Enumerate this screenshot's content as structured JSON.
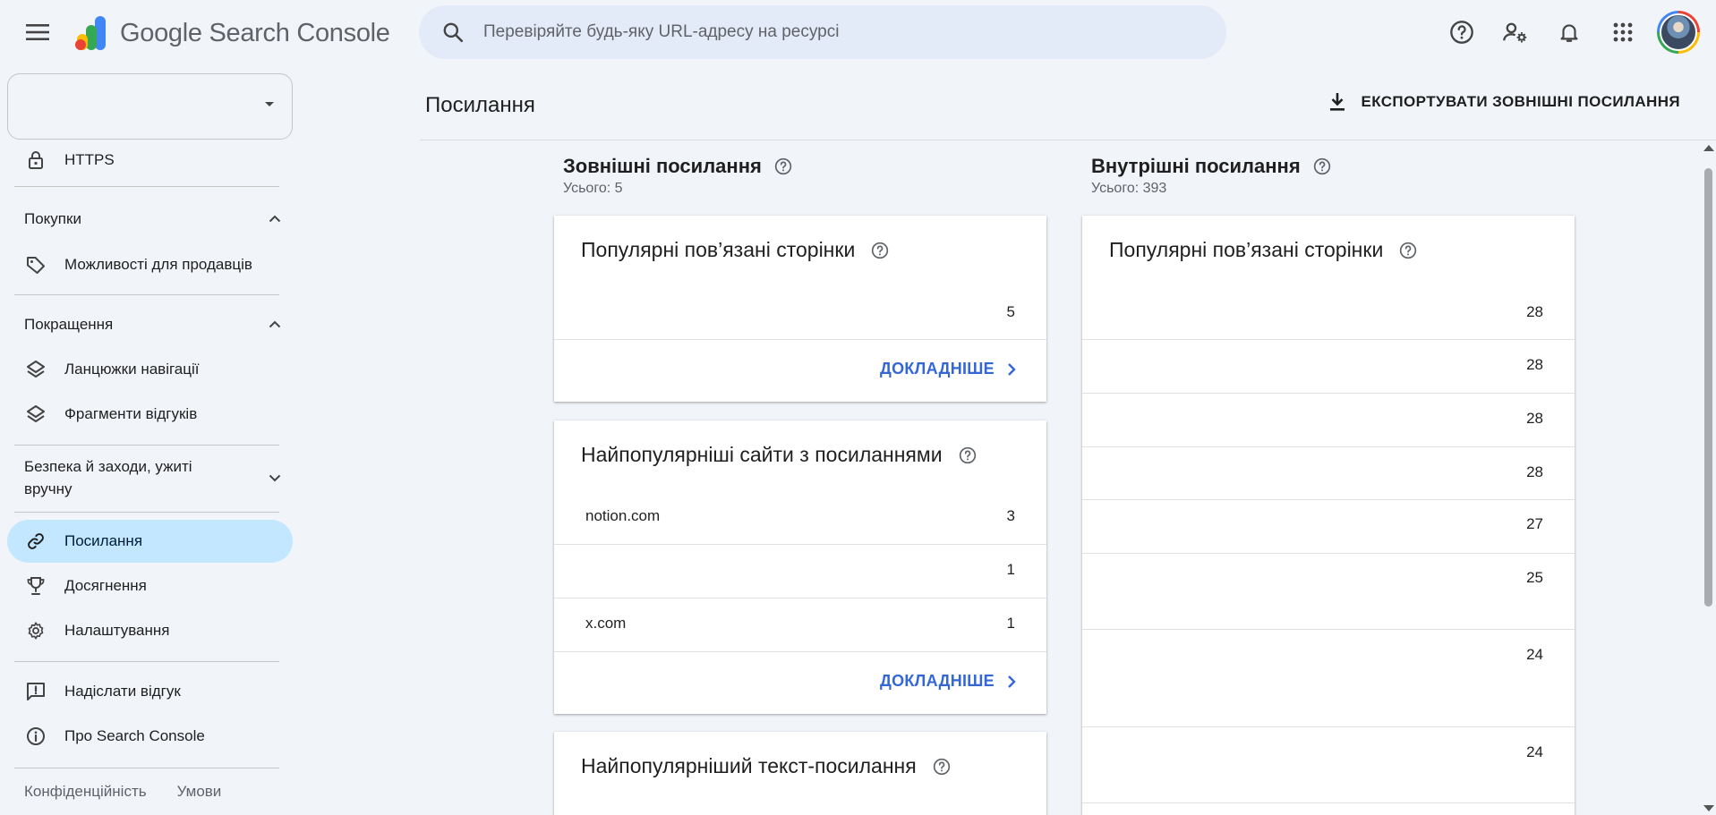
{
  "app": {
    "title_word1": "Google",
    "title_word2": "Search Console"
  },
  "search": {
    "placeholder": "Перевіряйте будь-яку URL-адресу на ресурсі"
  },
  "sidebar": {
    "https_label": "HTTPS",
    "sections": {
      "shopping": "Покупки",
      "enhancements": "Покращення",
      "security": "Безпека й заходи, ужиті вручну"
    },
    "items": {
      "merchant": "Можливості для продавців",
      "breadcrumbs": "Ланцюжки навігації",
      "reviews": "Фрагменти відгуків",
      "links": "Посилання",
      "achievements": "Досягнення",
      "settings": "Налаштування",
      "feedback": "Надіслати відгук",
      "about": "Про Search Console"
    },
    "footer": {
      "privacy": "Конфіденційність",
      "terms": "Умови"
    }
  },
  "page": {
    "title": "Посилання",
    "export_label": "ЕКСПОРТУВАТИ ЗОВНІШНІ ПОСИЛАННЯ"
  },
  "external": {
    "title": "Зовнішні посилання",
    "total": "Усього: 5",
    "top_pages": {
      "title": "Популярні пов’язані сторінки",
      "rows": [
        {
          "label": "",
          "value": "5"
        }
      ],
      "more": "ДОКЛАДНІШЕ"
    },
    "top_sites": {
      "title": "Найпопулярніші сайти з посиланнями",
      "rows": [
        {
          "label": "notion.com",
          "value": "3"
        },
        {
          "label": "",
          "value": "1"
        },
        {
          "label": "x.com",
          "value": "1"
        }
      ],
      "more": "ДОКЛАДНІШЕ"
    },
    "top_text": {
      "title": "Найпопулярніший текст-посилання"
    }
  },
  "internal": {
    "title": "Внутрішні посилання",
    "total": "Усього: 393",
    "top_pages": {
      "title": "Популярні пов’язані сторінки",
      "rows": [
        {
          "value": "28"
        },
        {
          "value": "28"
        },
        {
          "value": "28"
        },
        {
          "value": "28"
        },
        {
          "value": "27"
        },
        {
          "value": "25"
        },
        {
          "value": "24"
        },
        {
          "value": "24"
        }
      ]
    }
  },
  "colors": {
    "accent": "#3367d6",
    "active_nav": "#c2e7ff",
    "search_bg": "#e3ebf8",
    "page_bg": "#f1f4f9"
  }
}
